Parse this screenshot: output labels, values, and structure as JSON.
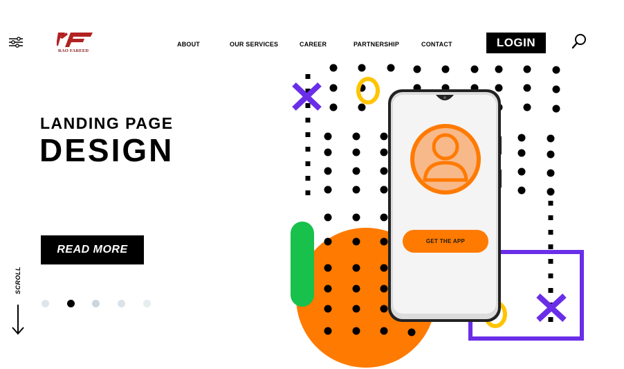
{
  "header": {
    "logo_text": "RAO FAREED",
    "nav": [
      "ABOUT",
      "OUR SERVICES",
      "CAREER",
      "PARTNERSHIP",
      "CONTACT"
    ],
    "login_label": "LOGIN"
  },
  "hero": {
    "subtitle": "LANDING PAGE",
    "title": "DESIGN",
    "cta_label": "READ MORE"
  },
  "scroll": {
    "label": "SCROLL"
  },
  "pagination": {
    "count": 5,
    "active_index": 1
  },
  "phone": {
    "button_label": "GET THE APP"
  },
  "colors": {
    "accent_orange": "#ff7a00",
    "accent_purple": "#6a2ee8",
    "accent_green": "#18c14b",
    "accent_yellow": "#ffc400",
    "dark": "#000000"
  },
  "icons": [
    "filter-icon",
    "search-icon",
    "user-icon",
    "arrow-down-icon"
  ]
}
